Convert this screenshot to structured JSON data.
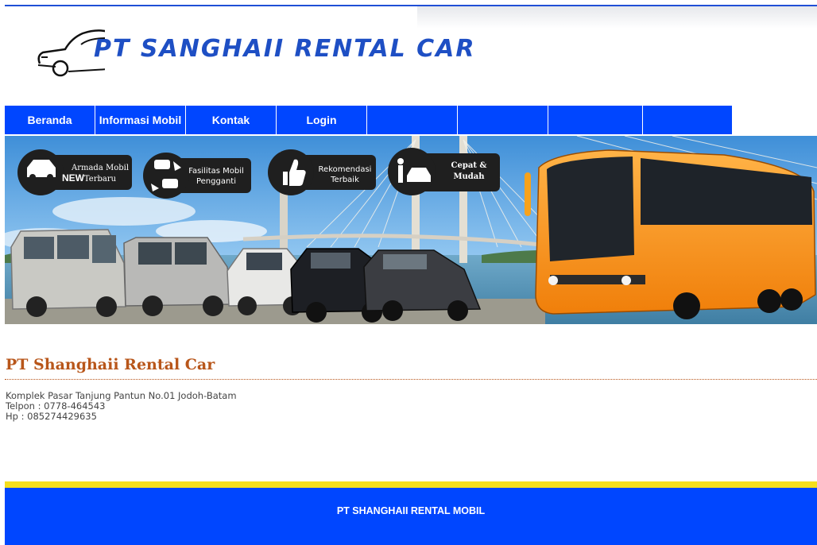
{
  "header": {
    "logo_text": "PT SANGHAII RENTAL CAR"
  },
  "nav": {
    "items": [
      {
        "label": "Beranda"
      },
      {
        "label": "Informasi Mobil"
      },
      {
        "label": "Kontak"
      },
      {
        "label": "Login"
      },
      {
        "label": ""
      },
      {
        "label": ""
      },
      {
        "label": ""
      },
      {
        "label": ""
      }
    ]
  },
  "banner": {
    "badges": [
      {
        "line1": "Armada Mobil",
        "line2": "Terbaru",
        "tag": "NEW",
        "icon": "car-icon"
      },
      {
        "line1": "Fasilitas Mobil",
        "line2": "Pengganti",
        "icon": "swap-cars-icon"
      },
      {
        "line1": "Rekomendasi",
        "line2": "Terbaik",
        "icon": "thumbs-up-icon"
      },
      {
        "line1": "Cepat &",
        "line2": "Mudah",
        "icon": "person-car-icon"
      }
    ]
  },
  "content": {
    "company_title": "PT Shanghaii Rental Car",
    "address": "Komplek Pasar Tanjung Pantun No.01 Jodoh-Batam",
    "phone": "Telpon : 0778-464543",
    "mobile": "Hp : 085274429635"
  },
  "footer": {
    "text": "PT SHANGHAII RENTAL MOBIL"
  },
  "colors": {
    "nav": "#0046ff",
    "footer": "#0046ff",
    "footer_stripe": "#f5df1d",
    "title": "#b8561a",
    "logo": "#1e4fc4",
    "bus": "#f7941d"
  }
}
